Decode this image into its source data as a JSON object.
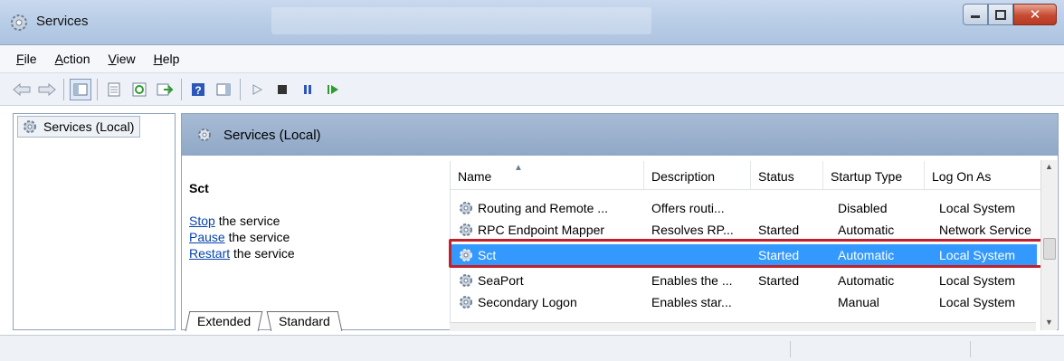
{
  "window": {
    "title": "Services"
  },
  "menu": {
    "items": [
      {
        "label": "File",
        "key": "F"
      },
      {
        "label": "Action",
        "key": "A"
      },
      {
        "label": "View",
        "key": "V"
      },
      {
        "label": "Help",
        "key": "H"
      }
    ]
  },
  "toolbar": {
    "icons": [
      "back-arrow-icon",
      "forward-arrow-icon",
      "show-hide-tree-icon",
      "properties-icon",
      "refresh-icon",
      "export-list-icon",
      "help-icon",
      "show-hide-action-pane-icon",
      "start-service-icon",
      "stop-service-icon",
      "pause-service-icon",
      "resume-service-icon"
    ]
  },
  "tree": {
    "item_label": "Services (Local)"
  },
  "right": {
    "header_label": "Services (Local)",
    "selected_service": "Sct",
    "actions": [
      {
        "link": "Stop",
        "rest": " the service"
      },
      {
        "link": "Pause",
        "rest": " the service"
      },
      {
        "link": "Restart",
        "rest": " the service"
      }
    ],
    "tabs": [
      "Extended",
      "Standard"
    ]
  },
  "list": {
    "columns": [
      "Name",
      "Description",
      "Status",
      "Startup Type",
      "Log On As"
    ],
    "rows": [
      {
        "name": "Routing and Remote ...",
        "description": "Offers routi...",
        "status": "",
        "startup": "Disabled",
        "logon": "Local System"
      },
      {
        "name": "RPC Endpoint Mapper",
        "description": "Resolves RP...",
        "status": "Started",
        "startup": "Automatic",
        "logon": "Network Service"
      },
      {
        "name": "Sct",
        "description": "",
        "status": "Started",
        "startup": "Automatic",
        "logon": "Local System"
      },
      {
        "name": "SeaPort",
        "description": "Enables the ...",
        "status": "Started",
        "startup": "Automatic",
        "logon": "Local System"
      },
      {
        "name": "Secondary Logon",
        "description": "Enables star...",
        "status": "",
        "startup": "Manual",
        "logon": "Local System"
      }
    ]
  },
  "colors": {
    "selection": "#3399ff",
    "highlight_border": "#c0202a",
    "link": "#0645ad"
  }
}
